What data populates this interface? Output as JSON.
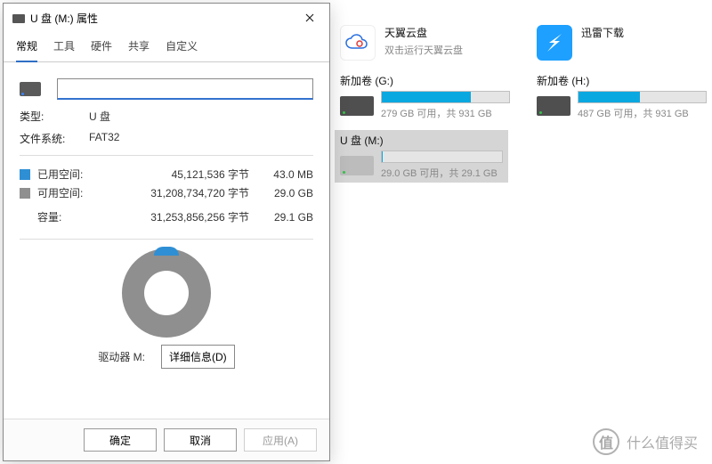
{
  "dialog": {
    "title": "U 盘 (M:) 属性",
    "tabs": [
      "常规",
      "工具",
      "硬件",
      "共享",
      "自定义"
    ],
    "active_tab": 0,
    "type_label": "类型:",
    "type_value": "U 盘",
    "fs_label": "文件系统:",
    "fs_value": "FAT32",
    "used_label": "已用空间:",
    "used_bytes": "45,121,536 字节",
    "used_h": "43.0 MB",
    "free_label": "可用空间:",
    "free_bytes": "31,208,734,720 字节",
    "free_h": "29.0 GB",
    "cap_label": "容量:",
    "cap_bytes": "31,253,856,256 字节",
    "cap_h": "29.1 GB",
    "donut_label": "驱动器 M:",
    "details_btn": "详细信息(D)",
    "ok": "确定",
    "cancel": "取消",
    "apply": "应用(A)"
  },
  "apps": {
    "cloud_name": "天翼云盘",
    "cloud_sub": "双击运行天翼云盘",
    "thunder_name": "迅雷下载"
  },
  "drives": {
    "g": {
      "title": "新加卷 (G:)",
      "info": "279 GB 可用，共 931 GB",
      "fill_pct": 70
    },
    "h": {
      "title": "新加卷 (H:)",
      "info": "487 GB 可用，共 931 GB",
      "fill_pct": 48
    },
    "m": {
      "title": "U 盘 (M:)",
      "info": "29.0 GB 可用，共 29.1 GB",
      "fill_pct": 1
    }
  },
  "watermark": "什么值得买"
}
